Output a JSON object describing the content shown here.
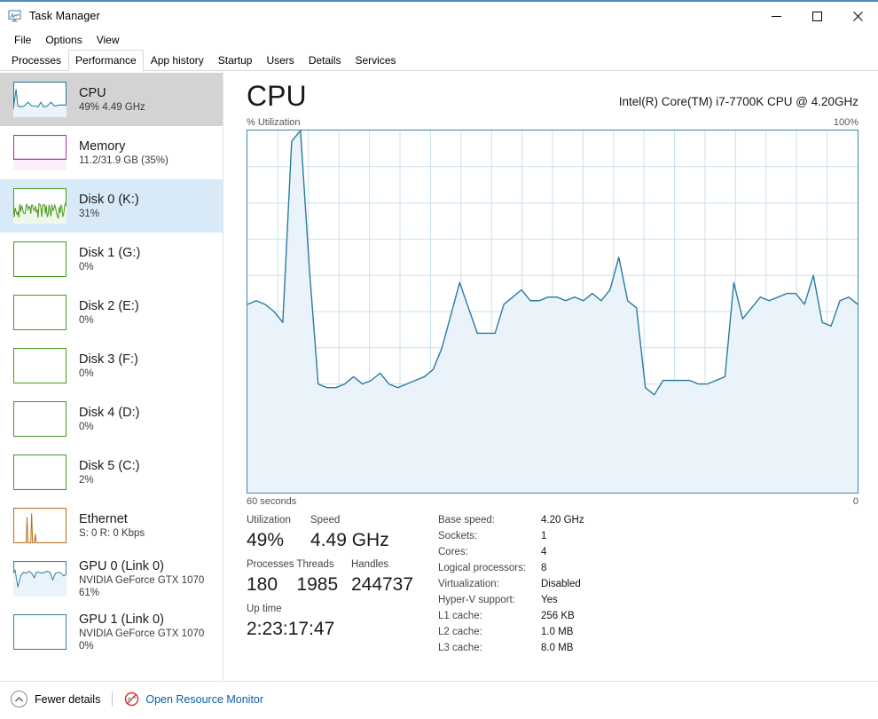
{
  "window": {
    "title": "Task Manager",
    "icon": "task-manager-icon",
    "controls": {
      "minimize": "—",
      "maximize": "☐",
      "close": "✕"
    }
  },
  "menu": {
    "items": [
      "File",
      "Options",
      "View"
    ]
  },
  "tabs": {
    "items": [
      "Processes",
      "Performance",
      "App history",
      "Startup",
      "Users",
      "Details",
      "Services"
    ],
    "active": "Performance"
  },
  "sidebar": {
    "items": [
      {
        "title": "CPU",
        "sub": "49%  4.49 GHz",
        "sub2": "",
        "state": "selected",
        "graph": "cpu"
      },
      {
        "title": "Memory",
        "sub": "11.2/31.9 GB (35%)",
        "sub2": "",
        "state": "normal",
        "graph": "memory"
      },
      {
        "title": "Disk 0 (K:)",
        "sub": "31%",
        "sub2": "",
        "state": "hovered",
        "graph": "disk-active"
      },
      {
        "title": "Disk 1 (G:)",
        "sub": "0%",
        "sub2": "",
        "state": "normal",
        "graph": "disk-idle"
      },
      {
        "title": "Disk 2 (E:)",
        "sub": "0%",
        "sub2": "",
        "state": "normal",
        "graph": "disk-idle"
      },
      {
        "title": "Disk 3 (F:)",
        "sub": "0%",
        "sub2": "",
        "state": "normal",
        "graph": "disk-idle"
      },
      {
        "title": "Disk 4 (D:)",
        "sub": "0%",
        "sub2": "",
        "state": "normal",
        "graph": "disk-idle"
      },
      {
        "title": "Disk 5 (C:)",
        "sub": "2%",
        "sub2": "",
        "state": "normal",
        "graph": "disk-idle"
      },
      {
        "title": "Ethernet",
        "sub": "S: 0 R: 0 Kbps",
        "sub2": "",
        "state": "normal",
        "graph": "ethernet"
      },
      {
        "title": "GPU 0 (Link 0)",
        "sub": "NVIDIA GeForce GTX 1070",
        "sub2": "61%",
        "state": "normal",
        "graph": "gpu-active"
      },
      {
        "title": "GPU 1 (Link 0)",
        "sub": "NVIDIA GeForce GTX 1070",
        "sub2": "0%",
        "state": "normal",
        "graph": "gpu-idle"
      }
    ]
  },
  "main": {
    "title": "CPU",
    "processor": "Intel(R) Core(TM) i7-7700K CPU @ 4.20GHz",
    "chart_axis_top_left": "% Utilization",
    "chart_axis_top_right": "100%",
    "chart_axis_bottom_left": "60 seconds",
    "chart_axis_bottom_right": "0"
  },
  "stats": {
    "utilization_label": "Utilization",
    "utilization_value": "49%",
    "speed_label": "Speed",
    "speed_value": "4.49 GHz",
    "processes_label": "Processes",
    "processes_value": "180",
    "threads_label": "Threads",
    "threads_value": "1985",
    "handles_label": "Handles",
    "handles_value": "244737",
    "uptime_label": "Up time",
    "uptime_value": "2:23:17:47",
    "details": [
      {
        "key": "Base speed:",
        "value": "4.20 GHz"
      },
      {
        "key": "Sockets:",
        "value": "1"
      },
      {
        "key": "Cores:",
        "value": "4"
      },
      {
        "key": "Logical processors:",
        "value": "8"
      },
      {
        "key": "Virtualization:",
        "value": "Disabled"
      },
      {
        "key": "Hyper-V support:",
        "value": "Yes"
      },
      {
        "key": "L1 cache:",
        "value": "256 KB"
      },
      {
        "key": "L2 cache:",
        "value": "1.0 MB"
      },
      {
        "key": "L3 cache:",
        "value": "8.0 MB"
      }
    ]
  },
  "statusbar": {
    "fewer_details": "Fewer details",
    "open_resource_monitor": "Open Resource Monitor"
  },
  "colors": {
    "cpu_line": "#2a7ba0",
    "cpu_fill": "#eaf3f9",
    "memory_line": "#a633a6",
    "disk_line": "#4e9a27",
    "ethernet_line": "#b8741f",
    "gpu_line": "#3a7fa8",
    "grid": "#c9e0ec",
    "selection": "#d3d3d3",
    "hover": "#d8eaf7",
    "link": "#0b5fa5",
    "titlebar_accent": "#4a8fc0"
  },
  "chart_data": {
    "type": "area",
    "title": "CPU % Utilization",
    "xlabel": "60 seconds",
    "ylabel": "% Utilization",
    "ylim": [
      0,
      100
    ],
    "xlim": [
      60,
      0
    ],
    "grid": true,
    "grid_cols": 20,
    "grid_rows": 10,
    "series": [
      {
        "name": "CPU utilization",
        "values": [
          52,
          53,
          52,
          50,
          47,
          97,
          100,
          62,
          30,
          29,
          29,
          30,
          32,
          30,
          31,
          33,
          30,
          29,
          30,
          31,
          32,
          34,
          40,
          49,
          58,
          51,
          44,
          44,
          44,
          52,
          54,
          56,
          53,
          53,
          54,
          54,
          53,
          54,
          53,
          55,
          53,
          56,
          65,
          53,
          51,
          29,
          27,
          31,
          31,
          31,
          31,
          30,
          30,
          31,
          32,
          58,
          48,
          51,
          54,
          53,
          54,
          55,
          55,
          52,
          60,
          47,
          46,
          53,
          54,
          52
        ]
      }
    ]
  }
}
